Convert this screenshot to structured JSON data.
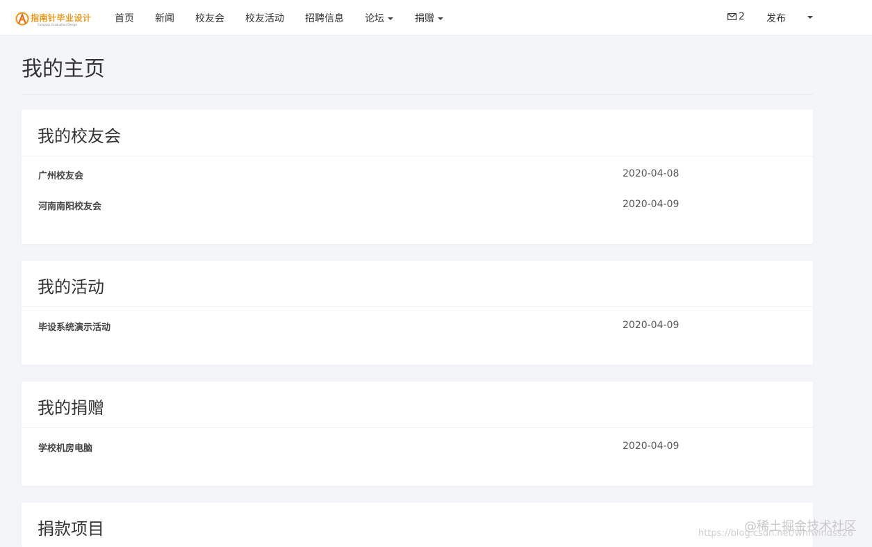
{
  "brand": {
    "title": "指南针毕业设计",
    "subtitle": "Compass Graduation Design",
    "color": "#f09a1e"
  },
  "nav": {
    "home": "首页",
    "news": "新闻",
    "alumni_association": "校友会",
    "alumni_activities": "校友活动",
    "recruitment": "招聘信息",
    "forum": "论坛",
    "donation": "捐赠"
  },
  "right_nav": {
    "messages_count": "2",
    "messages_icon": "mail-icon",
    "publish": "发布"
  },
  "page": {
    "title": "我的主页"
  },
  "panels": {
    "alumni": {
      "title": "我的校友会",
      "items": [
        {
          "name": "广州校友会",
          "date": "2020-04-08"
        },
        {
          "name": "河南南阳校友会",
          "date": "2020-04-09"
        }
      ]
    },
    "activities": {
      "title": "我的活动",
      "items": [
        {
          "name": "毕设系统演示活动",
          "date": "2020-04-09"
        }
      ]
    },
    "donations": {
      "title": "我的捐赠",
      "items": [
        {
          "name": "学校机房电脑",
          "date": "2020-04-09"
        }
      ]
    },
    "projects": {
      "title": "捐款项目"
    }
  },
  "watermark": {
    "line1": "@稀土掘金技术社区",
    "line2": "https://blog.csdn.net/whfwindss26"
  }
}
